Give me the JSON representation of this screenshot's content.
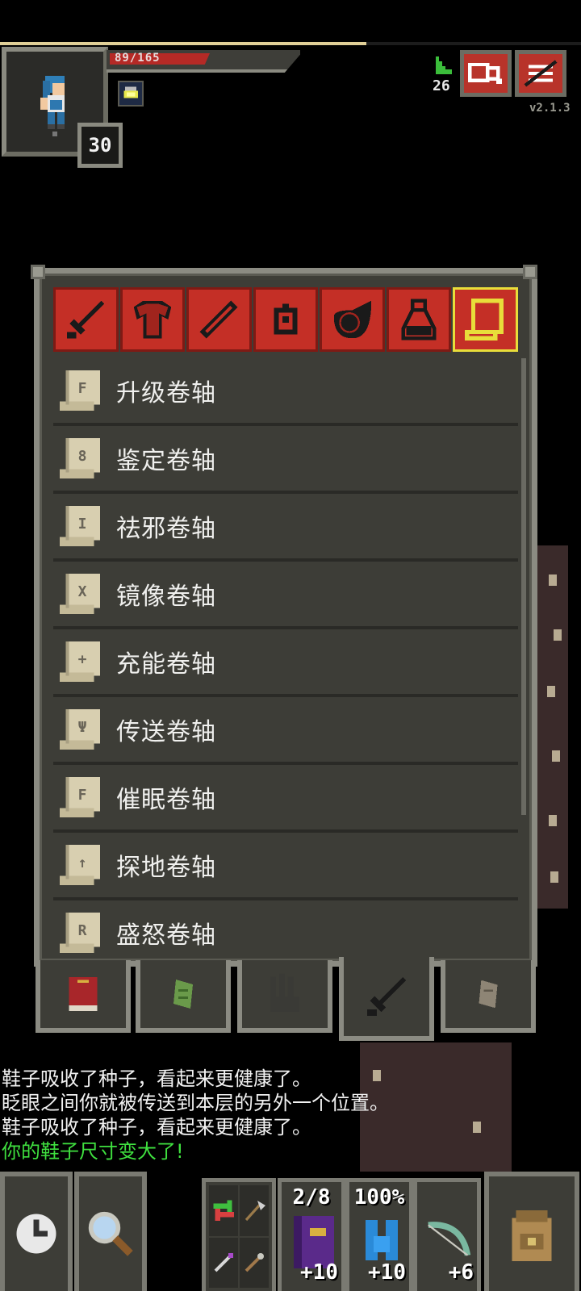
{
  "hero": {
    "hp_text": "89/165",
    "hp_fraction": 0.54,
    "xp_fraction": 0.63,
    "level": "30"
  },
  "header": {
    "depth": "26",
    "version": "v2.1.3",
    "journal_icon": "journal-search-icon",
    "menu_icon": "menu-icon"
  },
  "inventory": {
    "categories": [
      {
        "icon": "sword-icon"
      },
      {
        "icon": "armor-icon"
      },
      {
        "icon": "wand-icon"
      },
      {
        "icon": "ring-icon"
      },
      {
        "icon": "artifact-icon"
      },
      {
        "icon": "potion-icon"
      },
      {
        "icon": "scroll-icon",
        "active": true
      }
    ],
    "items": [
      {
        "name": "升级卷轴",
        "rune": "F"
      },
      {
        "name": "鉴定卷轴",
        "rune": "8"
      },
      {
        "name": "祛邪卷轴",
        "rune": "I"
      },
      {
        "name": "镜像卷轴",
        "rune": "X"
      },
      {
        "name": "充能卷轴",
        "rune": "+"
      },
      {
        "name": "传送卷轴",
        "rune": "Ψ"
      },
      {
        "name": "催眠卷轴",
        "rune": "F"
      },
      {
        "name": "探地卷轴",
        "rune": "↑"
      },
      {
        "name": "盛怒卷轴",
        "rune": "R"
      }
    ],
    "bags": [
      {
        "icon": "tome-icon"
      },
      {
        "icon": "seed-pouch-icon"
      },
      {
        "icon": "glove-icon"
      },
      {
        "icon": "weapon-tab-icon",
        "active": true
      },
      {
        "icon": "scroll-holder-icon"
      }
    ]
  },
  "log": [
    {
      "text": "鞋子吸收了种子，看起来更健康了。",
      "type": "normal"
    },
    {
      "text": "眨眼之间你就被传送到本层的另外一个位置。",
      "type": "normal"
    },
    {
      "text": "鞋子吸收了种子，看起来更健康了。",
      "type": "normal"
    },
    {
      "text": "你的鞋子尺寸变大了!",
      "type": "positive"
    }
  ],
  "toolbar": {
    "quickslots": [
      {
        "top": "2/8",
        "bottom": "+10",
        "icon": "spellbook-icon"
      },
      {
        "top": "100%",
        "bottom": "+10",
        "icon": "water-flask-icon"
      },
      {
        "top": "",
        "bottom": "+6",
        "icon": "bow-icon"
      }
    ]
  },
  "colors": {
    "tab_red": "#c42f26",
    "active_tab_outline": "#e8dd3a",
    "panel_bg": "#3d3d37",
    "log_positive": "#3fe03f"
  }
}
